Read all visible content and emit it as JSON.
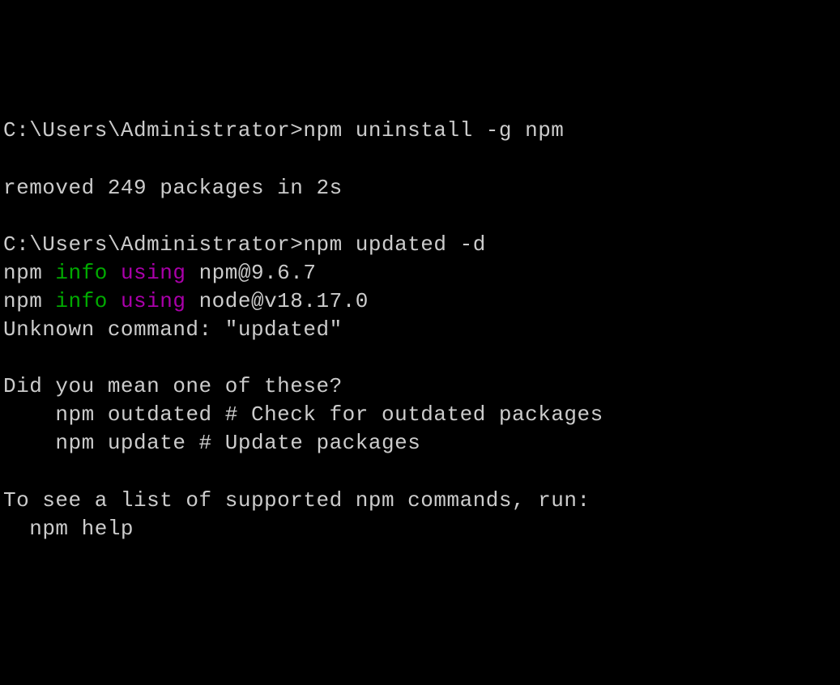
{
  "lines": [
    {
      "segments": [
        {
          "cls": "prompt",
          "text": "C:\\Users\\Administrator>"
        },
        {
          "cls": "cmd",
          "text": "npm uninstall -g npm"
        }
      ]
    },
    {
      "segments": []
    },
    {
      "segments": [
        {
          "cls": "txt",
          "text": "removed 249 packages in 2s"
        }
      ]
    },
    {
      "segments": []
    },
    {
      "segments": [
        {
          "cls": "prompt",
          "text": "C:\\Users\\Administrator>"
        },
        {
          "cls": "cmd",
          "text": "npm updated -d"
        }
      ]
    },
    {
      "segments": [
        {
          "cls": "txt",
          "text": "npm "
        },
        {
          "cls": "green",
          "text": "info"
        },
        {
          "cls": "txt",
          "text": " "
        },
        {
          "cls": "purple",
          "text": "using"
        },
        {
          "cls": "txt",
          "text": " npm@9.6.7"
        }
      ]
    },
    {
      "segments": [
        {
          "cls": "txt",
          "text": "npm "
        },
        {
          "cls": "green",
          "text": "info"
        },
        {
          "cls": "txt",
          "text": " "
        },
        {
          "cls": "purple",
          "text": "using"
        },
        {
          "cls": "txt",
          "text": " node@v18.17.0"
        }
      ]
    },
    {
      "segments": [
        {
          "cls": "txt",
          "text": "Unknown command: \"updated\""
        }
      ]
    },
    {
      "segments": []
    },
    {
      "segments": [
        {
          "cls": "txt",
          "text": "Did you mean one of these?"
        }
      ]
    },
    {
      "segments": [
        {
          "cls": "txt",
          "text": "    npm outdated # Check for outdated packages"
        }
      ]
    },
    {
      "segments": [
        {
          "cls": "txt",
          "text": "    npm update # Update packages"
        }
      ]
    },
    {
      "segments": []
    },
    {
      "segments": [
        {
          "cls": "txt",
          "text": "To see a list of supported npm commands, run:"
        }
      ]
    },
    {
      "segments": [
        {
          "cls": "txt",
          "text": "  npm help"
        }
      ]
    }
  ]
}
